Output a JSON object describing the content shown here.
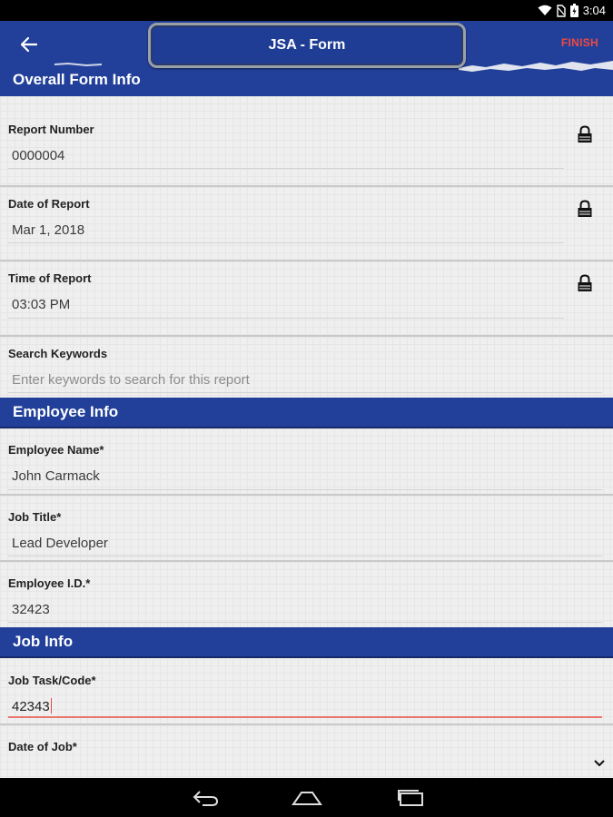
{
  "status_bar": {
    "time": "3:04"
  },
  "app_bar": {
    "title": "JSA - Form",
    "finish_label": "FINISH"
  },
  "sections": {
    "overall": "Overall Form Info",
    "employee": "Employee Info",
    "job": "Job Info"
  },
  "fields": {
    "report_number": {
      "label": "Report Number",
      "value": "0000004"
    },
    "date_of_report": {
      "label": "Date of Report",
      "value": "Mar 1, 2018"
    },
    "time_of_report": {
      "label": "Time of Report",
      "value": "03:03 PM"
    },
    "search_keywords": {
      "label": "Search Keywords",
      "placeholder": "Enter keywords to search for this report"
    },
    "employee_name": {
      "label": "Employee Name*",
      "value": "John Carmack"
    },
    "job_title": {
      "label": "Job Title*",
      "value": "Lead Developer"
    },
    "employee_id": {
      "label": "Employee I.D.*",
      "value": "32423"
    },
    "job_task_code": {
      "label": "Job Task/Code*",
      "value": "42343"
    },
    "date_of_job": {
      "label": "Date of Job*"
    }
  },
  "colors": {
    "brand_blue": "#22409a",
    "accent_red": "#ef4a3e"
  },
  "icons": [
    "back-arrow-icon",
    "lock-icon",
    "chevron-down-icon",
    "wifi-icon",
    "battery-icon",
    "nav-back-icon",
    "nav-home-icon",
    "nav-recents-icon"
  ]
}
